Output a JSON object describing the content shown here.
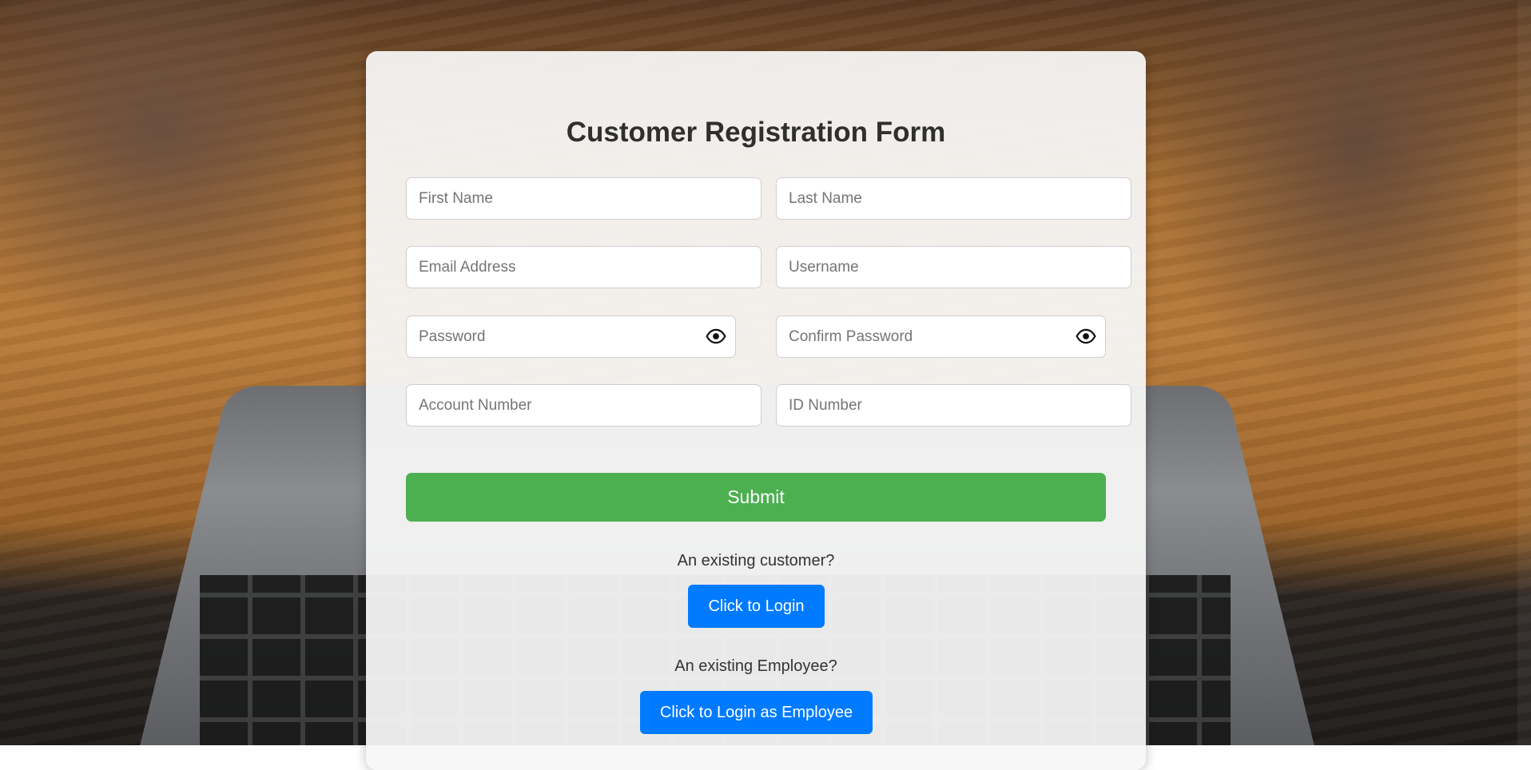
{
  "form": {
    "title": "Customer Registration Form",
    "fields": {
      "first_name": {
        "placeholder": "First Name",
        "value": ""
      },
      "last_name": {
        "placeholder": "Last Name",
        "value": ""
      },
      "email": {
        "placeholder": "Email Address",
        "value": ""
      },
      "username": {
        "placeholder": "Username",
        "value": ""
      },
      "password": {
        "placeholder": "Password",
        "value": ""
      },
      "confirm_password": {
        "placeholder": "Confirm Password",
        "value": ""
      },
      "account_number": {
        "placeholder": "Account Number",
        "value": ""
      },
      "id_number": {
        "placeholder": "ID Number",
        "value": ""
      }
    },
    "submit_label": "Submit"
  },
  "customer_login": {
    "prompt": "An existing customer?",
    "button_label": "Click to Login"
  },
  "employee_login": {
    "prompt": "An existing Employee?",
    "button_label": "Click to Login as Employee"
  },
  "icons": {
    "password_toggle": "eye-icon",
    "confirm_password_toggle": "eye-icon"
  },
  "colors": {
    "submit": "#4caf50",
    "link_buttons": "#007bff",
    "card_background": "#f6f6f6"
  }
}
